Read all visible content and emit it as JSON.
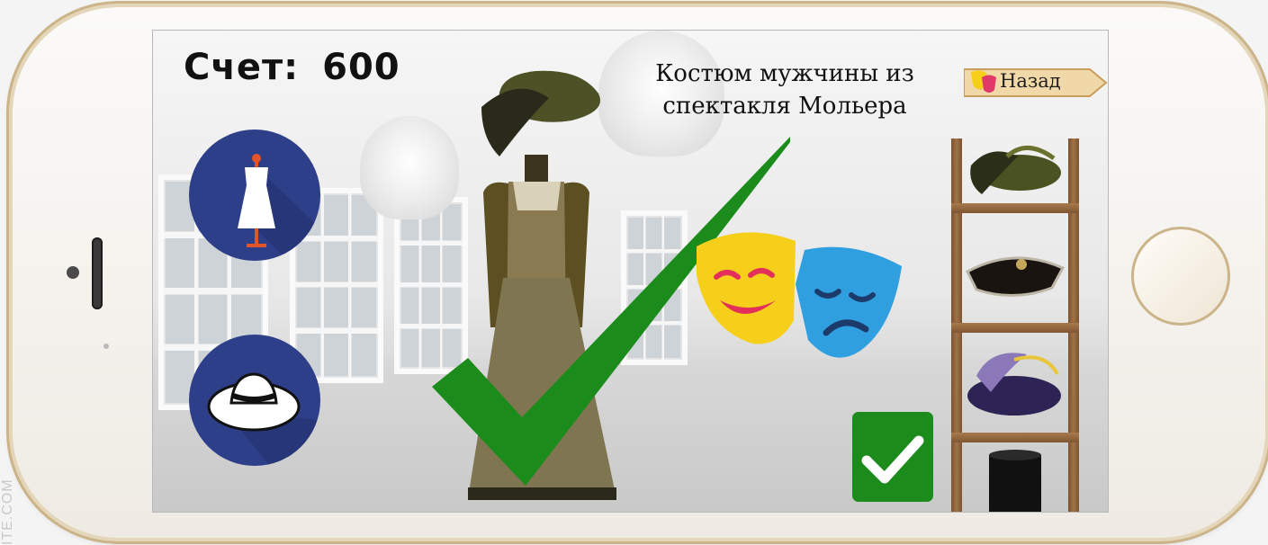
{
  "score": {
    "label": "Счет:",
    "value": "600"
  },
  "costume": {
    "title": "Костюм мужчины из спектакля Мольера"
  },
  "nav": {
    "back_label": "Назад"
  },
  "tools": [
    {
      "name": "dress-category",
      "icon": "dress-mannequin-icon"
    },
    {
      "name": "hat-category",
      "icon": "wide-brim-hat-icon"
    }
  ],
  "accessories": [
    {
      "name": "green-feather-hat",
      "icon": "feathered-hat-icon"
    },
    {
      "name": "black-tricorn-hat",
      "icon": "tricorn-hat-icon"
    },
    {
      "name": "purple-plumed-hat",
      "icon": "plumed-hat-icon"
    },
    {
      "name": "black-top-hat",
      "icon": "top-hat-icon"
    }
  ],
  "colors": {
    "accent_green": "#1b8c1b",
    "circle_blue": "#2e3f8a",
    "comedy_yellow": "#f5cf1a",
    "tragedy_blue": "#2f9fe0"
  },
  "watermark": "ITE.COM"
}
